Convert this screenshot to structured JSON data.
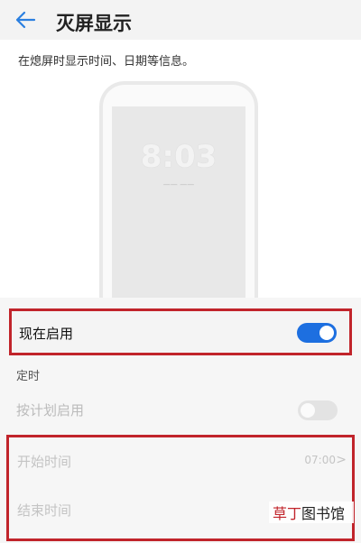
{
  "header": {
    "title": "灭屏显示"
  },
  "description": "在熄屏时显示时间、日期等信息。",
  "preview": {
    "clock": "8:03",
    "date_line": "—— ——"
  },
  "enable_now": {
    "label": "现在启用",
    "state": "on"
  },
  "schedule": {
    "section_title": "定时",
    "scheduled_label": "按计划启用",
    "scheduled_state": "off",
    "start": {
      "label": "开始时间",
      "value": "07:00"
    },
    "end": {
      "label": "结束时间",
      "value": ""
    }
  },
  "watermark": {
    "part1": "草丁",
    "part2": "图书馆"
  },
  "colors": {
    "accent_blue": "#1d6fe0",
    "highlight_red": "#c1242b"
  }
}
